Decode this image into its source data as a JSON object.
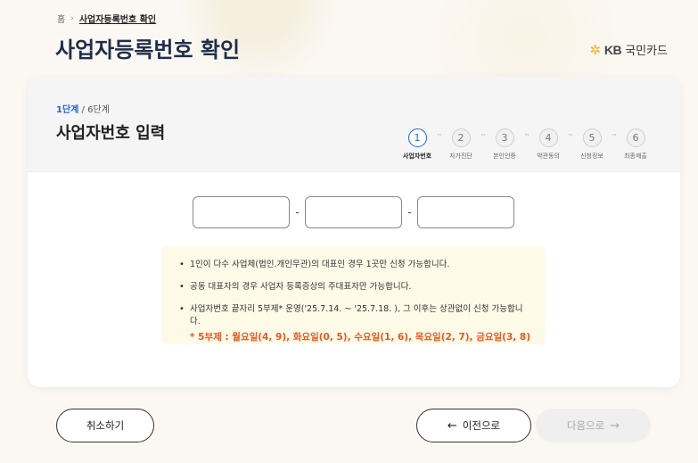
{
  "breadcrumb": {
    "home": "홈",
    "current": "사업자등록번호 확인"
  },
  "page": {
    "title": "사업자등록번호 확인"
  },
  "logo": {
    "brand": "KB",
    "name": "국민카드"
  },
  "card": {
    "step_current": "1단계",
    "step_total": "/ 6단계",
    "step_title": "사업자번호 입력"
  },
  "steps": [
    {
      "num": "1",
      "label": "사업자번호"
    },
    {
      "num": "2",
      "label": "자가진단"
    },
    {
      "num": "3",
      "label": "본인인증"
    },
    {
      "num": "4",
      "label": "약관동의"
    },
    {
      "num": "5",
      "label": "신청정보"
    },
    {
      "num": "6",
      "label": "최종제출"
    }
  ],
  "inputs": {
    "part1": "",
    "part2": "",
    "part3": "",
    "dash": "-"
  },
  "notice": {
    "item1": "1인이 다수 사업체(법인.개인무관)의 대표인 경우 1곳만 신청 가능합니다.",
    "item2": "공동 대표자의 경우 사업자 등록증상의 주대표자만 가능합니다.",
    "item3": "사업자번호 끝자리 5부제* 운영('25.7.14. ~ '25.7.18. ), 그 이후는 상관없이 신청 가능합니다.",
    "warn": "* 5부제 : 월요일(4, 9), 화요일(0, 5), 수요일(1, 6), 목요일(2, 7), 금요일(3, 8)"
  },
  "buttons": {
    "cancel": "취소하기",
    "prev": "이전으로",
    "next": "다음으로"
  },
  "icons": {
    "arrow_left": "←",
    "arrow_right": "→",
    "chevron_right": "›",
    "logo_star": "✲"
  },
  "colors": {
    "primary": "#1e64d6",
    "title": "#1f2f4a",
    "warning": "#e8571e",
    "notice_bg": "#fdfae8"
  }
}
